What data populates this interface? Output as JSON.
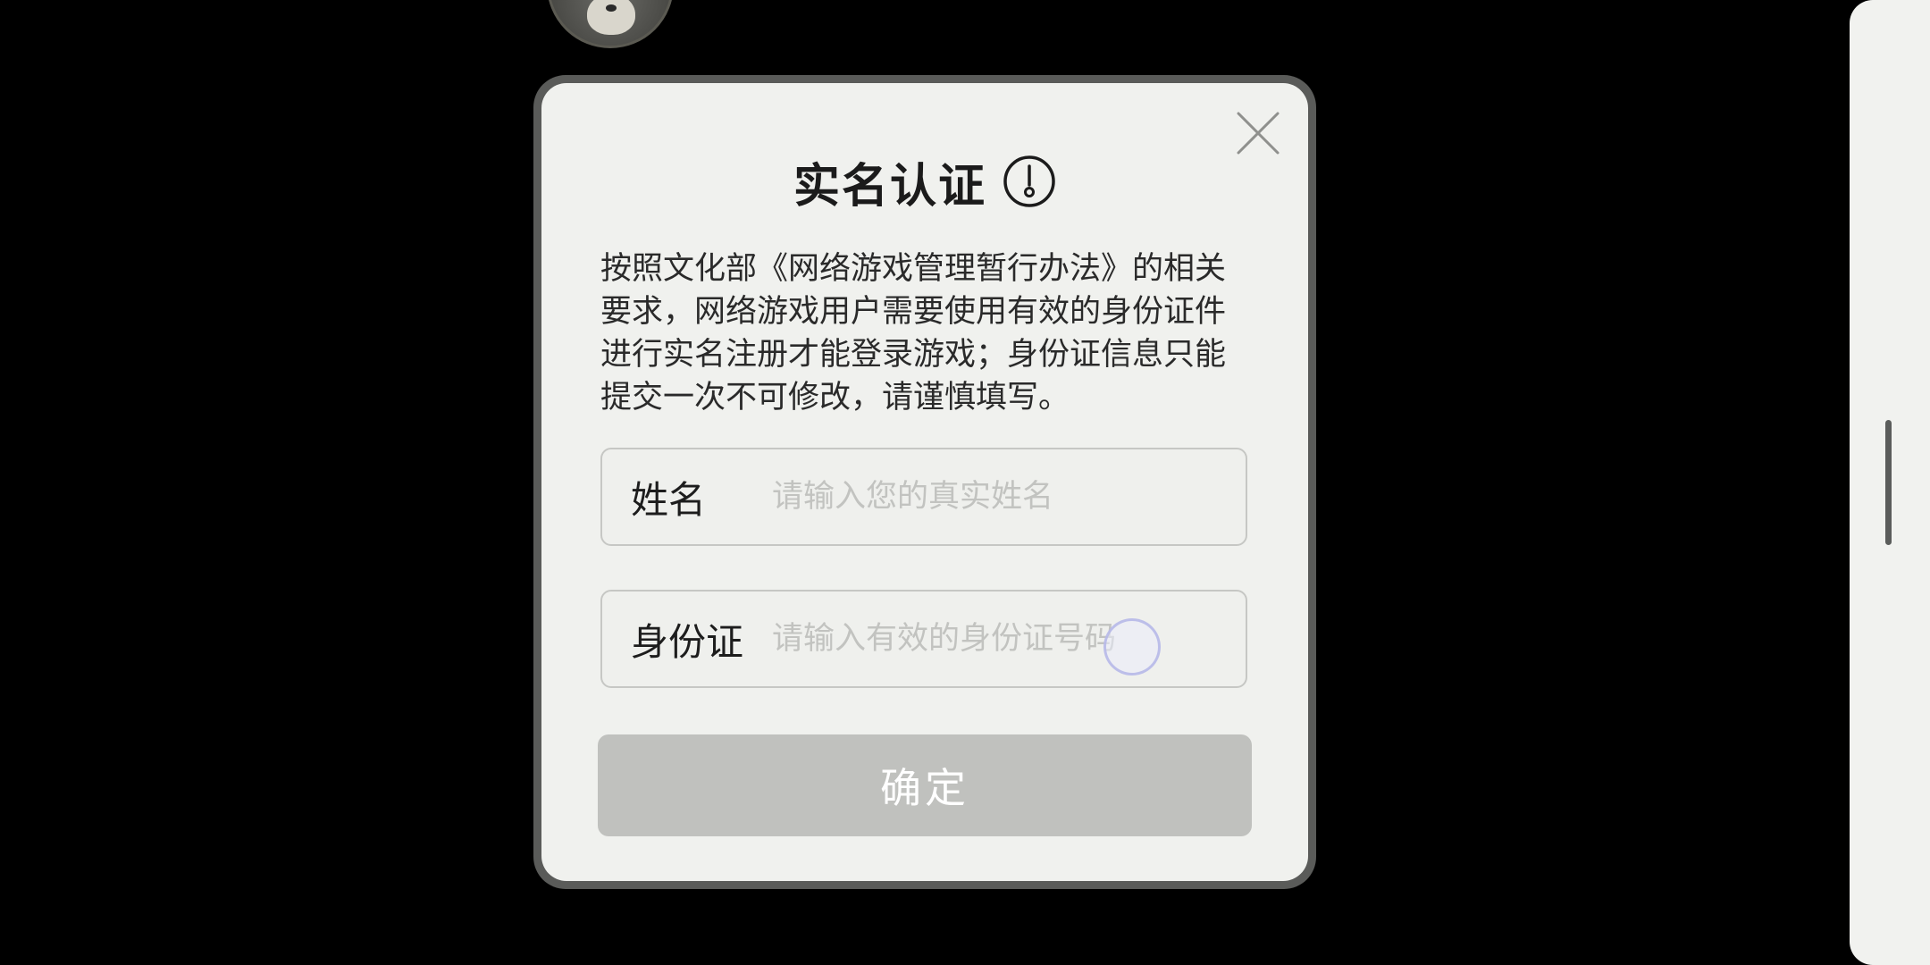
{
  "dialog": {
    "title": "实名认证",
    "description": "按照文化部《网络游戏管理暂行办法》的相关要求，网络游戏用户需要使用有效的身份证件进行实名注册才能登录游戏；身份证信息只能提交一次不可修改，请谨慎填写。",
    "name_field": {
      "label": "姓名",
      "placeholder": "请输入您的真实姓名",
      "value": ""
    },
    "id_field": {
      "label": "身份证",
      "placeholder": "请输入有效的身份证号码",
      "value": ""
    },
    "confirm_label": "确定"
  },
  "icons": {
    "close": "close-icon",
    "info": "exclamation-circle-icon",
    "avatar": "avatar-icon"
  },
  "colors": {
    "background": "#000000",
    "dialog_bg": "#f0f1ee",
    "dialog_border": "#5a5b59",
    "button_disabled": "#c0c1be",
    "placeholder": "#c2c3c0"
  }
}
